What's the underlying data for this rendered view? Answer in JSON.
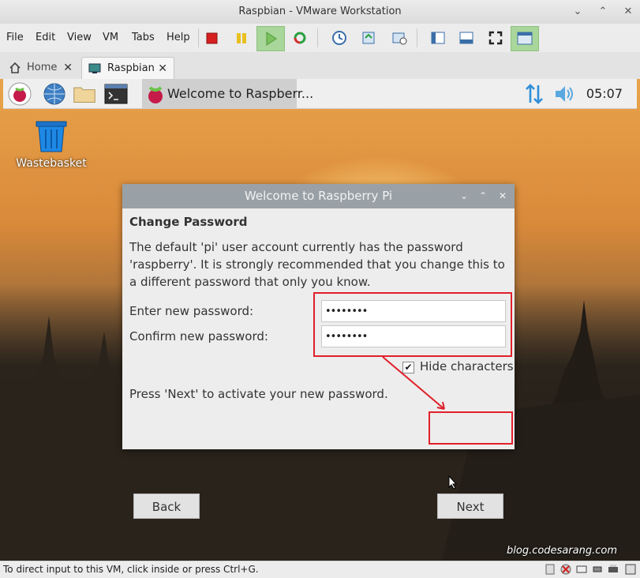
{
  "window": {
    "title": "Raspbian - VMware Workstation",
    "minimize": "⌄",
    "restore": "⌃",
    "close": "✕"
  },
  "menu": [
    "File",
    "Edit",
    "View",
    "VM",
    "Tabs",
    "Help"
  ],
  "tabs": [
    {
      "label": "Home",
      "close": "✕"
    },
    {
      "label": "Raspbian",
      "close": "✕"
    }
  ],
  "pi_panel": {
    "task_label": "Welcome to Raspberr...",
    "clock": "05:07"
  },
  "desktop": {
    "wastebasket_label": "Wastebasket",
    "watermark": "blog.codesarang.com"
  },
  "dialog": {
    "title": "Welcome to Raspberry Pi",
    "heading": "Change Password",
    "description": "The default 'pi' user account currently has the password 'raspberry'. It is strongly recommended that you change this to a different password that only you know.",
    "enter_label": "Enter new password:",
    "enter_value": "••••••••",
    "confirm_label": "Confirm new password:",
    "confirm_value": "••••••••",
    "hide_label": "Hide characters",
    "hide_checked": true,
    "hide_check_glyph": "✔",
    "hint": "Press 'Next' to activate your new password.",
    "back_label": "Back",
    "next_label": "Next"
  },
  "status": {
    "text": "To direct input to this VM, click inside or press Ctrl+G."
  },
  "colors": {
    "highlight": "#e0202a",
    "title_bar": "#9aa1a6",
    "dialog_bg": "#ededed"
  }
}
